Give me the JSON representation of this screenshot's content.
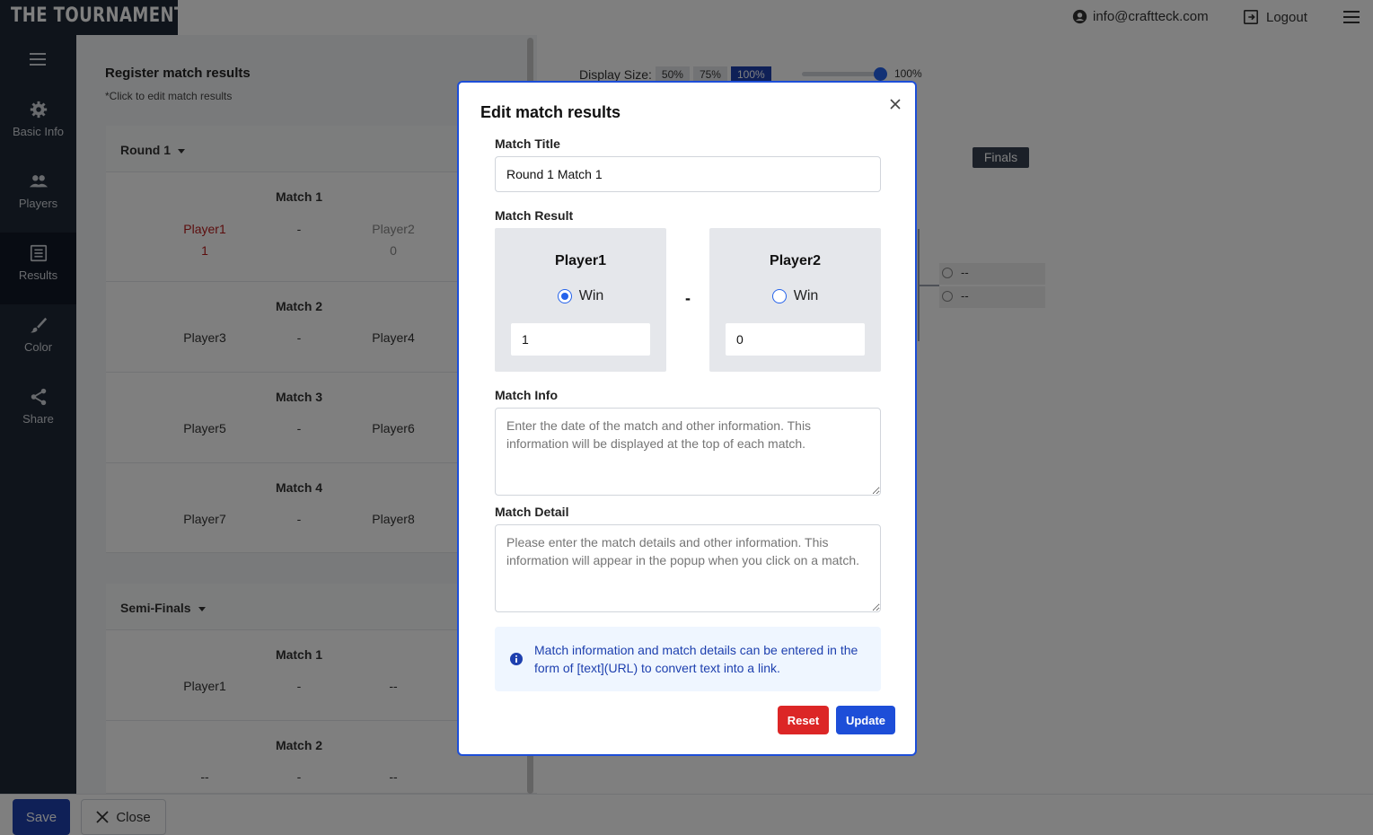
{
  "app": {
    "logo": "THE TOURNAMENT"
  },
  "topbar": {
    "email": "info@craftteck.com",
    "logout": "Logout"
  },
  "sidebar": {
    "items": [
      {
        "label": "Basic Info",
        "icon": "gear-icon"
      },
      {
        "label": "Players",
        "icon": "users-icon"
      },
      {
        "label": "Results",
        "icon": "list-icon",
        "active": true
      },
      {
        "label": "Color",
        "icon": "brush-icon"
      },
      {
        "label": "Share",
        "icon": "share-icon"
      }
    ]
  },
  "panel": {
    "title": "Register match results",
    "subtitle": "*Click to edit match results",
    "rounds": [
      {
        "name": "Round 1",
        "matches": [
          {
            "title": "Match 1",
            "p1": "Player1",
            "p2": "Player2",
            "dash": "-",
            "s1": "1",
            "s2": "0"
          },
          {
            "title": "Match 2",
            "p1": "Player3",
            "p2": "Player4",
            "dash": "-"
          },
          {
            "title": "Match 3",
            "p1": "Player5",
            "p2": "Player6",
            "dash": "-"
          },
          {
            "title": "Match 4",
            "p1": "Player7",
            "p2": "Player8",
            "dash": "-"
          }
        ]
      },
      {
        "name": "Semi-Finals",
        "matches": [
          {
            "title": "Match 1",
            "p1": "Player1",
            "p2": "--",
            "dash": "-"
          },
          {
            "title": "Match 2",
            "p1": "--",
            "p2": "--",
            "dash": "-"
          }
        ]
      }
    ]
  },
  "preview": {
    "display_size_label": "Display Size:",
    "sizes": [
      "50%",
      "75%",
      "100%"
    ],
    "selected_size": "100%",
    "zoom_value": "100%",
    "finals_label": "Finals",
    "slots": [
      "--",
      "--"
    ]
  },
  "bottom": {
    "save": "Save",
    "close": "Close"
  },
  "modal": {
    "title": "Edit match results",
    "match_title_label": "Match Title",
    "match_title_value": "Round 1 Match 1",
    "match_result_label": "Match Result",
    "player1": {
      "name": "Player1",
      "win_label": "Win",
      "score": "1",
      "win": true
    },
    "player2": {
      "name": "Player2",
      "win_label": "Win",
      "score": "0",
      "win": false
    },
    "dash": "-",
    "match_info_label": "Match Info",
    "match_info_placeholder": "Enter the date of the match and other information. This information will be displayed at the top of each match.",
    "match_detail_label": "Match Detail",
    "match_detail_placeholder": "Please enter the match details and other information. This information will appear in the popup when you click on a match.",
    "info_text": "Match information and match details can be entered in the form of [text](URL) to convert text into a link.",
    "reset": "Reset",
    "update": "Update"
  },
  "colors": {
    "accent": "#1d4ed8",
    "danger": "#dc2626",
    "sidebar": "#1f2937",
    "winner": "#b91c1c"
  }
}
